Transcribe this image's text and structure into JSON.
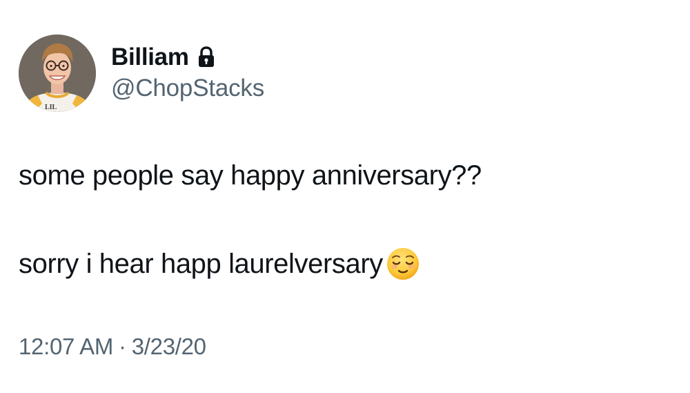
{
  "author": {
    "display_name": "Billiam",
    "handle": "@ChopStacks",
    "protected_icon": "lock-icon",
    "avatar_shirt_text": "LIL"
  },
  "tweet": {
    "line_1": "some people say happy anniversary??",
    "line_2": "sorry i hear happ laurelversary",
    "line_2_emoji": "relieved-face-emoji"
  },
  "meta": {
    "time": "12:07 AM",
    "separator": "·",
    "date": "3/23/20"
  },
  "colors": {
    "text_primary": "#0f1419",
    "text_secondary": "#536471",
    "background": "#ffffff"
  }
}
